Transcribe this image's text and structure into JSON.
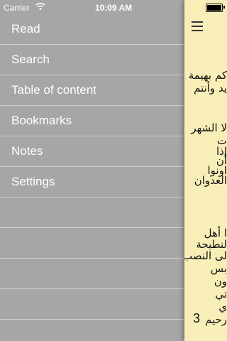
{
  "status": {
    "carrier": "Carrier",
    "time": "10:09 AM"
  },
  "menu": {
    "items": [
      {
        "label": "Read"
      },
      {
        "label": "Search"
      },
      {
        "label": "Table of content"
      },
      {
        "label": "Bookmarks"
      },
      {
        "label": "Notes"
      },
      {
        "label": "Settings"
      }
    ]
  },
  "content": {
    "lines": [
      "كم بهيمة",
      "يد وأنتم",
      "لا الشهر",
      "ت",
      "إذا",
      "أن",
      "اونوا",
      "العدوان",
      "ا أهل",
      "لنطيحة",
      "لى النصب",
      "بس",
      "ون",
      "تي",
      "ي"
    ],
    "last_line": "رحيم",
    "ayah_number": "3"
  }
}
